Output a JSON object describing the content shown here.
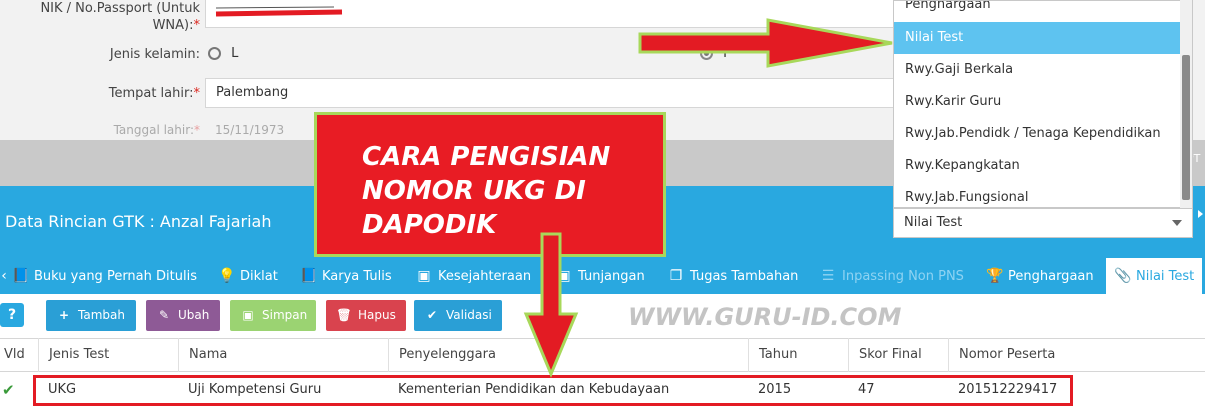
{
  "form": {
    "nik_label": "NIK / No.Passport (Untuk WNA):",
    "nik_label_line1": "NIK / No.Passport (Untuk",
    "nik_label_line2": "WNA):",
    "required_mark": "*",
    "gender_label": "Jenis kelamin:",
    "gender_option_l": "L",
    "gender_option_p": "P",
    "birthplace_label": "Tempat lahir:",
    "birthplace_value": "Palembang",
    "birthdate_label": "Tanggal lahir:",
    "birthdate_value": "15/11/1973",
    "right_clip_text": "PT"
  },
  "header": {
    "title": "Data Rincian GTK : Anzal Fajariah"
  },
  "dropdown": {
    "items": [
      "Penghargaan",
      "Nilai Test",
      "Rwy.Gaji Berkala",
      "Rwy.Karir Guru",
      "Rwy.Jab.Pendidk / Tenaga Kependidikan",
      "Rwy.Kepangkatan",
      "Rwy.Jab.Fungsional"
    ],
    "selected_index": 1,
    "selected_value": "Nilai Test"
  },
  "tabs": [
    {
      "label": "Buku yang Pernah Ditulis",
      "icon": "book-icon",
      "state": "normal"
    },
    {
      "label": "Diklat",
      "icon": "lightbulb-icon",
      "state": "normal"
    },
    {
      "label": "Karya Tulis",
      "icon": "book-icon",
      "state": "normal"
    },
    {
      "label": "Kesejahteraan",
      "icon": "money-icon",
      "state": "normal"
    },
    {
      "label": "Tunjangan",
      "icon": "money-icon",
      "state": "normal"
    },
    {
      "label": "Tugas Tambahan",
      "icon": "copy-icon",
      "state": "normal"
    },
    {
      "label": "Inpassing Non PNS",
      "icon": "list-icon",
      "state": "disabled"
    },
    {
      "label": "Penghargaan",
      "icon": "trophy-icon",
      "state": "normal"
    },
    {
      "label": "Nilai Test",
      "icon": "paperclip-icon",
      "state": "active"
    }
  ],
  "toolbar": {
    "help": "?",
    "tambah": "Tambah",
    "ubah": "Ubah",
    "simpan": "Simpan",
    "hapus": "Hapus",
    "validasi": "Validasi"
  },
  "grid": {
    "columns": [
      "Vld",
      "Jenis Test",
      "Nama",
      "Penyelenggara",
      "Tahun",
      "Skor Final",
      "Nomor Peserta"
    ],
    "rows": [
      {
        "vld": "✔",
        "jenis_test": "UKG",
        "nama": "Uji Kompetensi Guru",
        "penyelenggara": "Kementerian Pendidikan dan Kebudayaan",
        "tahun": "2015",
        "skor_final": "47",
        "nomor_peserta": "201512229417"
      }
    ]
  },
  "overlay": {
    "callout_line1": "CARA PENGISIAN",
    "callout_line2": "NOMOR UKG DI",
    "callout_line3": "DAPODIK",
    "watermark": "WWW.GURU-ID.COM"
  },
  "colors": {
    "primary_blue": "#29a8e0",
    "selected_blue": "#5ec3f0",
    "callout_red": "#e81c24",
    "arrow_outline_green": "#a8d85a",
    "btn_tambah": "#2a9fd6",
    "btn_ubah": "#8e5a96",
    "btn_simpan": "#9bd372",
    "btn_hapus": "#d9434e",
    "btn_validasi": "#2a9fd6"
  }
}
